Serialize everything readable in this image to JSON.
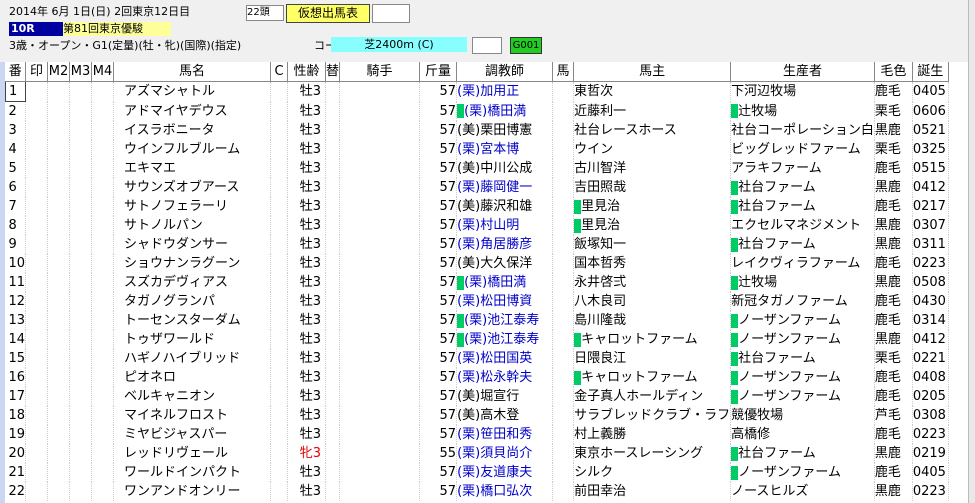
{
  "header": {
    "date": "2014年 6月 1日(日)",
    "meeting": "2回東京12日目",
    "head_count": "22頭",
    "yoso_button": "仮想出馬表",
    "race_no": "10R",
    "race_name": "第81回東京優駿",
    "conditions": "3歳・オープン・G1(定量)(牡・牝)(国際)(指定)",
    "course_label": "コース図",
    "course": "芝2400m (C)",
    "grade_code": "G001"
  },
  "columns": [
    "番",
    "印",
    "M2",
    "M3",
    "M4",
    "馬名",
    "C",
    "性齢",
    "替",
    "騎手",
    "斤量",
    "調教師",
    "馬",
    "馬主",
    "生産者",
    "毛色",
    "誕生"
  ],
  "colors": {
    "trainer_blue": "#0000c8",
    "filly_red": "#e00000",
    "marker_green": "#00cc66",
    "race_badge": "#0000a0"
  },
  "rows": [
    {
      "no": "1",
      "name": "アズマシャトル",
      "sex_age": "牡3",
      "weight": "57",
      "trainer": "(栗)加用正",
      "owner": "東哲次",
      "breeder": "下河辺牧場",
      "color": "鹿毛",
      "birth": "0405"
    },
    {
      "no": "2",
      "name": "アドマイヤデウス",
      "sex_age": "牡3",
      "weight": "57",
      "trainer": "(栗)橋田満",
      "owner": "近藤利一",
      "breeder": "辻牧場",
      "color": "栗毛",
      "birth": "0606"
    },
    {
      "no": "3",
      "name": "イスラボニータ",
      "sex_age": "牡3",
      "weight": "57",
      "trainer": "(美)栗田博憲",
      "owner": "社台レースホース",
      "breeder": "社台コーポレーション白",
      "color": "黒鹿",
      "birth": "0521"
    },
    {
      "no": "4",
      "name": "ウインフルブルーム",
      "sex_age": "牡3",
      "weight": "57",
      "trainer": "(栗)宮本博",
      "owner": "ウイン",
      "breeder": "ビッグレッドファーム",
      "color": "栗毛",
      "birth": "0325"
    },
    {
      "no": "5",
      "name": "エキマエ",
      "sex_age": "牡3",
      "weight": "57",
      "trainer": "(美)中川公成",
      "owner": "古川智洋",
      "breeder": "アラキファーム",
      "color": "鹿毛",
      "birth": "0515"
    },
    {
      "no": "6",
      "name": "サウンズオブアース",
      "sex_age": "牡3",
      "weight": "57",
      "trainer": "(栗)藤岡健一",
      "owner": "吉田照哉",
      "breeder": "社台ファーム",
      "color": "黒鹿",
      "birth": "0412"
    },
    {
      "no": "7",
      "name": "サトノフェラーリ",
      "sex_age": "牡3",
      "weight": "57",
      "trainer": "(美)藤沢和雄",
      "owner": "里見治",
      "breeder": "社台ファーム",
      "color": "鹿毛",
      "birth": "0217"
    },
    {
      "no": "8",
      "name": "サトノルパン",
      "sex_age": "牡3",
      "weight": "57",
      "trainer": "(栗)村山明",
      "owner": "里見治",
      "breeder": "エクセルマネジメント",
      "color": "黒鹿",
      "birth": "0307"
    },
    {
      "no": "9",
      "name": "シャドウダンサー",
      "sex_age": "牡3",
      "weight": "57",
      "trainer": "(栗)角居勝彦",
      "owner": "飯塚知一",
      "breeder": "社台ファーム",
      "color": "黒鹿",
      "birth": "0311"
    },
    {
      "no": "10",
      "name": "ショウナンラグーン",
      "sex_age": "牡3",
      "weight": "57",
      "trainer": "(美)大久保洋",
      "owner": "国本哲秀",
      "breeder": "レイクヴィラファーム",
      "color": "鹿毛",
      "birth": "0223"
    },
    {
      "no": "11",
      "name": "スズカデヴィアス",
      "sex_age": "牡3",
      "weight": "57",
      "trainer": "(栗)橋田満",
      "owner": "永井啓弍",
      "breeder": "辻牧場",
      "color": "黒鹿",
      "birth": "0508"
    },
    {
      "no": "12",
      "name": "タガノグランパ",
      "sex_age": "牡3",
      "weight": "57",
      "trainer": "(栗)松田博資",
      "owner": "八木良司",
      "breeder": "新冠タガノファーム",
      "color": "鹿毛",
      "birth": "0430"
    },
    {
      "no": "13",
      "name": "トーセンスターダム",
      "sex_age": "牡3",
      "weight": "57",
      "trainer": "(栗)池江泰寿",
      "owner": "島川隆哉",
      "breeder": "ノーザンファーム",
      "color": "鹿毛",
      "birth": "0314"
    },
    {
      "no": "14",
      "name": "トゥザワールド",
      "sex_age": "牡3",
      "weight": "57",
      "trainer": "(栗)池江泰寿",
      "owner": "キャロットファーム",
      "breeder": "ノーザンファーム",
      "color": "黒鹿",
      "birth": "0412"
    },
    {
      "no": "15",
      "name": "ハギノハイブリッド",
      "sex_age": "牡3",
      "weight": "57",
      "trainer": "(栗)松田国英",
      "owner": "日隈良江",
      "breeder": "社台ファーム",
      "color": "栗毛",
      "birth": "0221"
    },
    {
      "no": "16",
      "name": "ピオネロ",
      "sex_age": "牡3",
      "weight": "57",
      "trainer": "(栗)松永幹夫",
      "owner": "キャロットファーム",
      "breeder": "ノーザンファーム",
      "color": "鹿毛",
      "birth": "0408"
    },
    {
      "no": "17",
      "name": "ベルキャニオン",
      "sex_age": "牡3",
      "weight": "57",
      "trainer": "(美)堀宣行",
      "owner": "金子真人ホールディン",
      "breeder": "ノーザンファーム",
      "color": "鹿毛",
      "birth": "0205"
    },
    {
      "no": "18",
      "name": "マイネルフロスト",
      "sex_age": "牡3",
      "weight": "57",
      "trainer": "(美)高木登",
      "owner": "サラブレッドクラブ・ラフ",
      "breeder": "競優牧場",
      "color": "芦毛",
      "birth": "0308"
    },
    {
      "no": "19",
      "name": "ミヤビジャスパー",
      "sex_age": "牡3",
      "weight": "57",
      "trainer": "(栗)笹田和秀",
      "owner": "村上義勝",
      "breeder": "高橋修",
      "color": "鹿毛",
      "birth": "0223"
    },
    {
      "no": "20",
      "name": "レッドリヴェール",
      "sex_age": "牝3",
      "weight": "55",
      "trainer": "(栗)須貝尚介",
      "owner": "東京ホースレーシング",
      "breeder": "社台ファーム",
      "color": "黒鹿",
      "birth": "0219"
    },
    {
      "no": "21",
      "name": "ワールドインパクト",
      "sex_age": "牡3",
      "weight": "57",
      "trainer": "(栗)友道康夫",
      "owner": "シルク",
      "breeder": "ノーザンファーム",
      "color": "鹿毛",
      "birth": "0405"
    },
    {
      "no": "22",
      "name": "ワンアンドオンリー",
      "sex_age": "牡3",
      "weight": "57",
      "trainer": "(栗)橋口弘次",
      "owner": "前田幸治",
      "breeder": "ノースヒルズ",
      "color": "黒鹿",
      "birth": "0223"
    }
  ]
}
